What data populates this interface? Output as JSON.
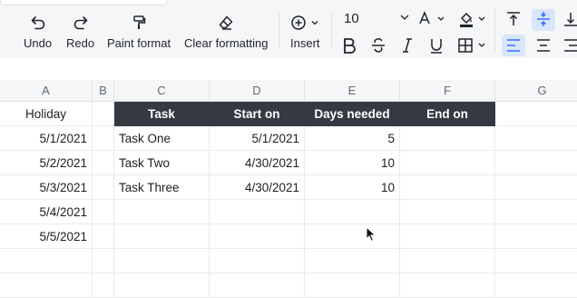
{
  "toolbar": {
    "undo": "Undo",
    "redo": "Redo",
    "paint_format": "Paint format",
    "clear_formatting": "Clear formatting",
    "insert": "Insert",
    "font_size": "10"
  },
  "icons": {
    "undo": "undo-icon",
    "redo": "redo-icon",
    "paint": "paint-roller-icon",
    "eraser": "eraser-icon",
    "insert": "plus-circle-icon",
    "text_color": "text-color-icon",
    "fill_color": "fill-color-icon",
    "bold": "bold-icon",
    "strike": "strikethrough-icon",
    "italic": "italic-icon",
    "underline": "underline-icon",
    "borders": "borders-icon",
    "align_top": "align-top-icon",
    "align_middle": "align-middle-icon",
    "align_bottom": "align-bottom-icon",
    "align_left": "align-left-icon",
    "align_center": "align-center-icon",
    "align_right": "align-right-icon"
  },
  "columns": [
    "A",
    "B",
    "C",
    "D",
    "E",
    "F",
    "G"
  ],
  "sheet": {
    "a1": "Holiday",
    "header": {
      "c": "Task",
      "d": "Start on",
      "e": "Days needed",
      "f": "End on"
    },
    "rows": [
      {
        "a": "5/1/2021",
        "c": "Task One",
        "d": "5/1/2021",
        "e": "5"
      },
      {
        "a": "5/2/2021",
        "c": "Task Two",
        "d": "4/30/2021",
        "e": "10"
      },
      {
        "a": "5/3/2021",
        "c": "Task Three",
        "d": "4/30/2021",
        "e": "10"
      },
      {
        "a": "5/4/2021",
        "c": "",
        "d": "",
        "e": ""
      },
      {
        "a": "5/5/2021",
        "c": "",
        "d": "",
        "e": ""
      },
      {
        "a": "",
        "c": "",
        "d": "",
        "e": ""
      }
    ]
  },
  "colors": {
    "header_fill": "#353a42",
    "accent": "#3370ff",
    "active_bg": "#d9e5fd"
  }
}
